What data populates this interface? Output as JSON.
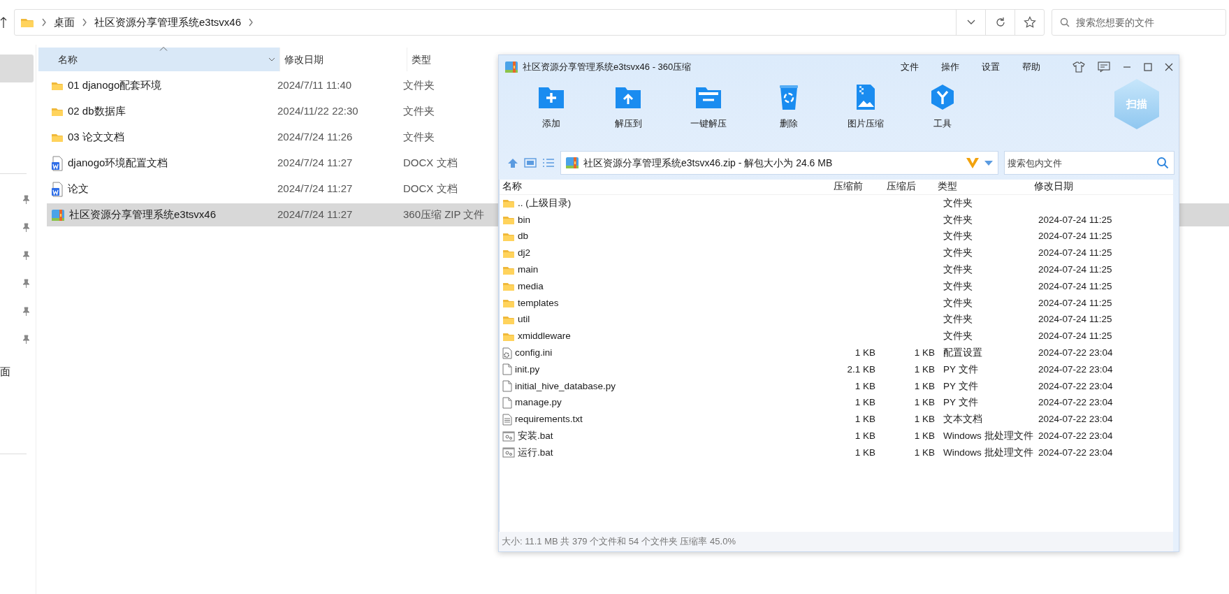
{
  "explorer": {
    "breadcrumb": [
      "桌面",
      "社区资源分享管理系统e3tsvx46"
    ],
    "search": {
      "placeholder": "搜索您想要的文件"
    },
    "sidebar": {
      "partial_label": "面"
    },
    "columns": [
      {
        "label": "名称",
        "sorted": true
      },
      {
        "label": "修改日期",
        "sorted": false
      },
      {
        "label": "类型",
        "sorted": false
      }
    ],
    "rows": [
      {
        "kind": "folder",
        "name": "01 djanogo配套环境",
        "date": "2024/7/11 11:40",
        "type": "文件夹",
        "selected": false
      },
      {
        "kind": "folder",
        "name": "02 db数据库",
        "date": "2024/11/22 22:30",
        "type": "文件夹",
        "selected": false
      },
      {
        "kind": "folder",
        "name": "03 论文文档",
        "date": "2024/7/24 11:26",
        "type": "文件夹",
        "selected": false
      },
      {
        "kind": "docx",
        "name": "djanogo环境配置文档",
        "date": "2024/7/24 11:27",
        "type": "DOCX 文档",
        "selected": false
      },
      {
        "kind": "docx",
        "name": "论文",
        "date": "2024/7/24 11:27",
        "type": "DOCX 文档",
        "selected": false
      },
      {
        "kind": "zip",
        "name": "社区资源分享管理系统e3tsvx46",
        "date": "2024/7/24 11:27",
        "type": "360压缩 ZIP 文件",
        "selected": true
      }
    ]
  },
  "archive_window": {
    "title": "社区资源分享管理系统e3tsvx46 - 360压缩",
    "menu": [
      "文件",
      "操作",
      "设置",
      "帮助"
    ],
    "toolbar": [
      {
        "kind": "add",
        "label": "添加"
      },
      {
        "kind": "extract_to",
        "label": "解压到"
      },
      {
        "kind": "extract",
        "label": "一键解压"
      },
      {
        "kind": "delete",
        "label": "删除"
      },
      {
        "kind": "image",
        "label": "图片压缩"
      },
      {
        "kind": "tools",
        "label": "工具"
      }
    ],
    "scan_label": "扫描",
    "path": "社区资源分享管理系统e3tsvx46.zip - 解包大小为 24.6 MB",
    "search": {
      "placeholder": "搜索包内文件"
    },
    "columns": [
      "名称",
      "压缩前",
      "压缩后",
      "类型",
      "修改日期"
    ],
    "rows": [
      {
        "kind": "folder",
        "name": ".. (上级目录)",
        "type": "文件夹"
      },
      {
        "kind": "folder",
        "name": "bin",
        "type": "文件夹",
        "date": "2024-07-24 11:25"
      },
      {
        "kind": "folder",
        "name": "db",
        "type": "文件夹",
        "date": "2024-07-24 11:25"
      },
      {
        "kind": "folder",
        "name": "dj2",
        "type": "文件夹",
        "date": "2024-07-24 11:25"
      },
      {
        "kind": "folder",
        "name": "main",
        "type": "文件夹",
        "date": "2024-07-24 11:25"
      },
      {
        "kind": "folder",
        "name": "media",
        "type": "文件夹",
        "date": "2024-07-24 11:25"
      },
      {
        "kind": "folder",
        "name": "templates",
        "type": "文件夹",
        "date": "2024-07-24 11:25"
      },
      {
        "kind": "folder",
        "name": "util",
        "type": "文件夹",
        "date": "2024-07-24 11:25"
      },
      {
        "kind": "folder",
        "name": "xmiddleware",
        "type": "文件夹",
        "date": "2024-07-24 11:25"
      },
      {
        "kind": "config",
        "name": "config.ini",
        "before": "1 KB",
        "after": "1 KB",
        "type": "配置设置",
        "date": "2024-07-22 23:04"
      },
      {
        "kind": "file",
        "name": "init.py",
        "before": "2.1 KB",
        "after": "1 KB",
        "type": "PY 文件",
        "date": "2024-07-22 23:04"
      },
      {
        "kind": "file",
        "name": "initial_hive_database.py",
        "before": "1 KB",
        "after": "1 KB",
        "type": "PY 文件",
        "date": "2024-07-22 23:04"
      },
      {
        "kind": "file",
        "name": "manage.py",
        "before": "1 KB",
        "after": "1 KB",
        "type": "PY 文件",
        "date": "2024-07-22 23:04"
      },
      {
        "kind": "text",
        "name": "requirements.txt",
        "before": "1 KB",
        "after": "1 KB",
        "type": "文本文档",
        "date": "2024-07-22 23:04"
      },
      {
        "kind": "batch",
        "name": "安装.bat",
        "before": "1 KB",
        "after": "1 KB",
        "type": "Windows 批处理文件",
        "date": "2024-07-22 23:04"
      },
      {
        "kind": "batch",
        "name": "运行.bat",
        "before": "1 KB",
        "after": "1 KB",
        "type": "Windows 批处理文件",
        "date": "2024-07-22 23:04"
      }
    ],
    "status_bar": "大小: 11.1 MB 共 379 个文件和 54 个文件夹 压缩率 45.0%"
  }
}
